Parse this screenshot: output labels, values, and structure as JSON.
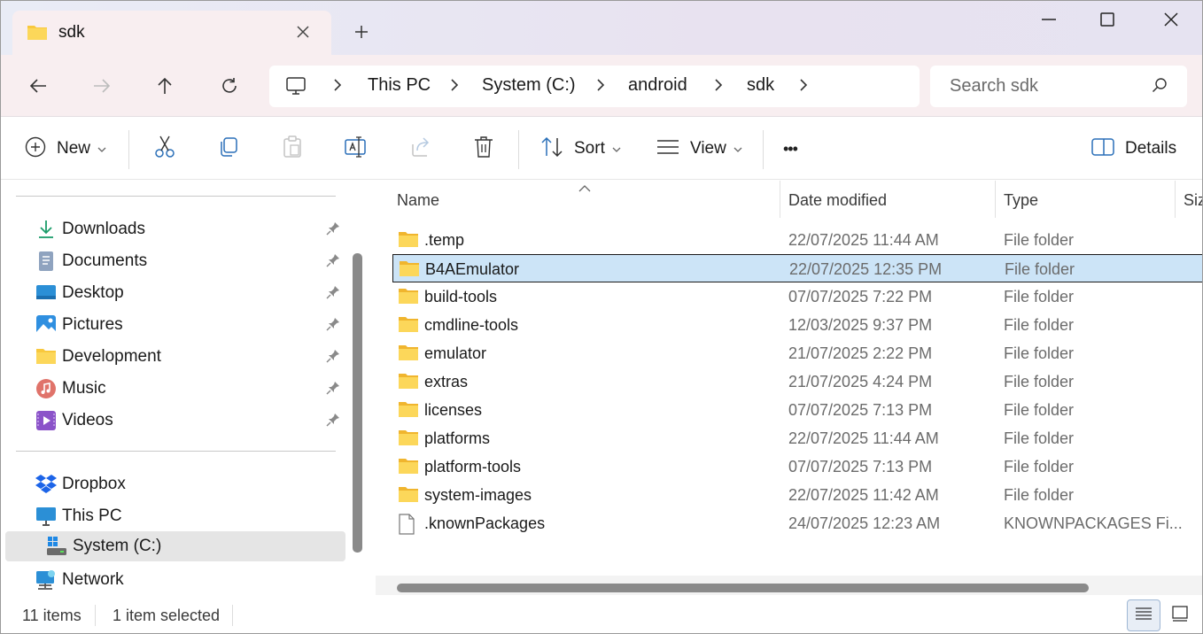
{
  "window": {
    "tab_title": "sdk",
    "new_tab_symbol": "+"
  },
  "address": {
    "crumbs": [
      "This PC",
      "System (C:)",
      "android",
      "sdk"
    ]
  },
  "search": {
    "placeholder": "Search sdk"
  },
  "toolbar": {
    "new_label": "New",
    "sort_label": "Sort",
    "view_label": "View",
    "more_label": "•••",
    "details_label": "Details"
  },
  "sidebar": {
    "quick_access": [
      {
        "label": "Downloads",
        "icon": "downloads-icon"
      },
      {
        "label": "Documents",
        "icon": "documents-icon"
      },
      {
        "label": "Desktop",
        "icon": "desktop-icon"
      },
      {
        "label": "Pictures",
        "icon": "pictures-icon"
      },
      {
        "label": "Development",
        "icon": "folder-icon"
      },
      {
        "label": "Music",
        "icon": "music-icon"
      },
      {
        "label": "Videos",
        "icon": "videos-icon"
      }
    ],
    "locations": [
      {
        "label": "Dropbox",
        "icon": "dropbox-icon"
      },
      {
        "label": "This PC",
        "icon": "this-pc-icon"
      },
      {
        "label": "System (C:)",
        "icon": "drive-icon",
        "selected": true
      },
      {
        "label": "Network",
        "icon": "network-icon"
      }
    ]
  },
  "columns": {
    "name": "Name",
    "date": "Date modified",
    "type": "Type",
    "size": "Siz"
  },
  "files": [
    {
      "name": ".temp",
      "date": "22/07/2025 11:44 AM",
      "type": "File folder",
      "kind": "folder"
    },
    {
      "name": "B4AEmulator",
      "date": "22/07/2025 12:35 PM",
      "type": "File folder",
      "kind": "folder",
      "selected": true
    },
    {
      "name": "build-tools",
      "date": "07/07/2025 7:22 PM",
      "type": "File folder",
      "kind": "folder"
    },
    {
      "name": "cmdline-tools",
      "date": "12/03/2025 9:37 PM",
      "type": "File folder",
      "kind": "folder"
    },
    {
      "name": "emulator",
      "date": "21/07/2025 2:22 PM",
      "type": "File folder",
      "kind": "folder"
    },
    {
      "name": "extras",
      "date": "21/07/2025 4:24 PM",
      "type": "File folder",
      "kind": "folder"
    },
    {
      "name": "licenses",
      "date": "07/07/2025 7:13 PM",
      "type": "File folder",
      "kind": "folder"
    },
    {
      "name": "platforms",
      "date": "22/07/2025 11:44 AM",
      "type": "File folder",
      "kind": "folder"
    },
    {
      "name": "platform-tools",
      "date": "07/07/2025 7:13 PM",
      "type": "File folder",
      "kind": "folder"
    },
    {
      "name": "system-images",
      "date": "22/07/2025 11:42 AM",
      "type": "File folder",
      "kind": "folder"
    },
    {
      "name": ".knownPackages",
      "date": "24/07/2025 12:23 AM",
      "type": "KNOWNPACKAGES Fi...",
      "kind": "file"
    }
  ],
  "status": {
    "item_count": "11 items",
    "selection": "1 item selected"
  },
  "colors": {
    "selection_bg": "#cce4f7",
    "folder_yellow": "#f8c83d",
    "accent": "#0067c0"
  }
}
